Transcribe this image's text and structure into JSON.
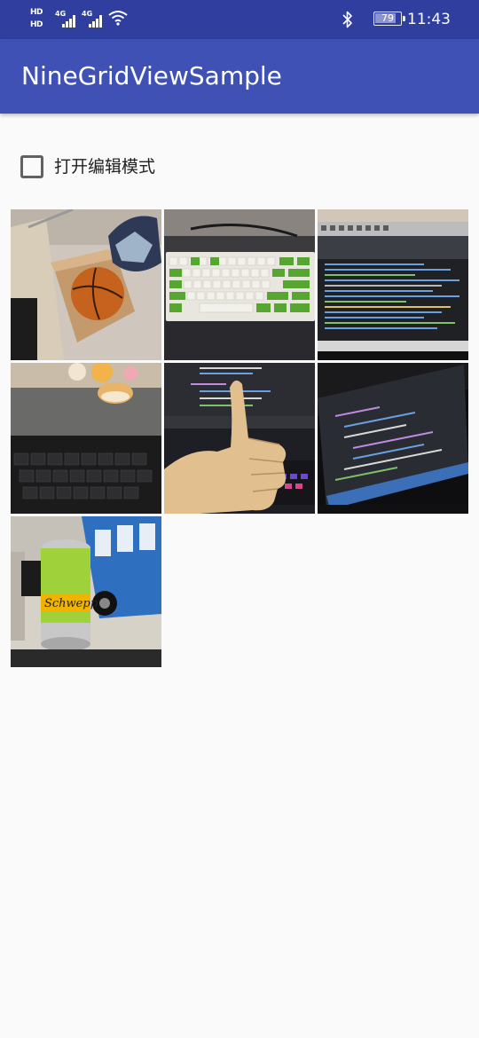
{
  "status_bar": {
    "hd_labels": [
      "HD",
      "HD"
    ],
    "signal_gens": [
      "4G",
      "4G"
    ],
    "battery": "79",
    "time": "11:43"
  },
  "app_bar": {
    "title": "NineGridViewSample"
  },
  "edit_mode": {
    "label": "打开编辑模式",
    "checked": false
  },
  "grid": {
    "images": [
      {
        "subject": "basketball-in-box"
      },
      {
        "subject": "mechanical-keyboard"
      },
      {
        "subject": "ide-console-monitor"
      },
      {
        "subject": "desk-keyboard-toys"
      },
      {
        "subject": "thumbs-up"
      },
      {
        "subject": "code-editor-monitor"
      },
      {
        "subject": "schweppes-can"
      }
    ]
  }
}
